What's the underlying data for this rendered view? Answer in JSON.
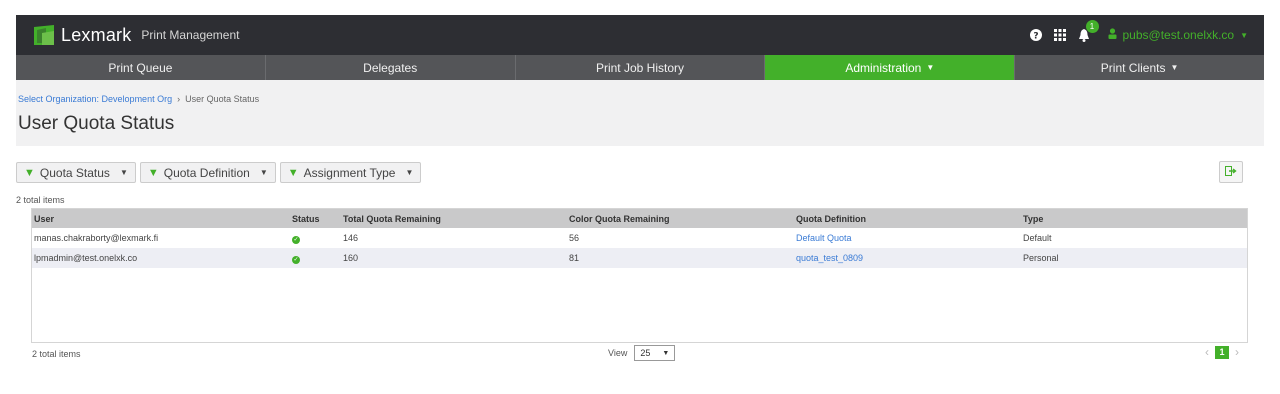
{
  "header": {
    "brand": "Lexmark",
    "product": "Print Management",
    "notification_count": "1",
    "user_email": "pubs@test.onelxk.co"
  },
  "nav": {
    "items": [
      {
        "label": "Print Queue"
      },
      {
        "label": "Delegates"
      },
      {
        "label": "Print Job History"
      },
      {
        "label": "Administration"
      },
      {
        "label": "Print Clients"
      }
    ],
    "active_index": 3
  },
  "breadcrumb": {
    "link": "Select Organization: Development Org",
    "separator": "›",
    "current": "User Quota Status"
  },
  "page_title": "User Quota Status",
  "filters": [
    {
      "label": "Quota Status"
    },
    {
      "label": "Quota Definition"
    },
    {
      "label": "Assignment Type"
    }
  ],
  "total_items_top": "2 total items",
  "table": {
    "columns": [
      "User",
      "Status",
      "Total Quota Remaining",
      "Color Quota Remaining",
      "Quota Definition",
      "Type"
    ],
    "rows": [
      {
        "user": "manas.chakraborty@lexmark.fi",
        "total": "146",
        "color": "56",
        "definition": "Default Quota",
        "type": "Default"
      },
      {
        "user": "lpmadmin@test.onelxk.co",
        "total": "160",
        "color": "81",
        "definition": "quota_test_0809",
        "type": "Personal"
      }
    ]
  },
  "footer": {
    "total_items": "2 total items",
    "view_label": "View",
    "page_size": "25",
    "current_page": "1"
  },
  "colors": {
    "accent": "#43b02a",
    "topbar": "#2d2e33",
    "navbar": "#545558",
    "link": "#3a7bd5"
  }
}
